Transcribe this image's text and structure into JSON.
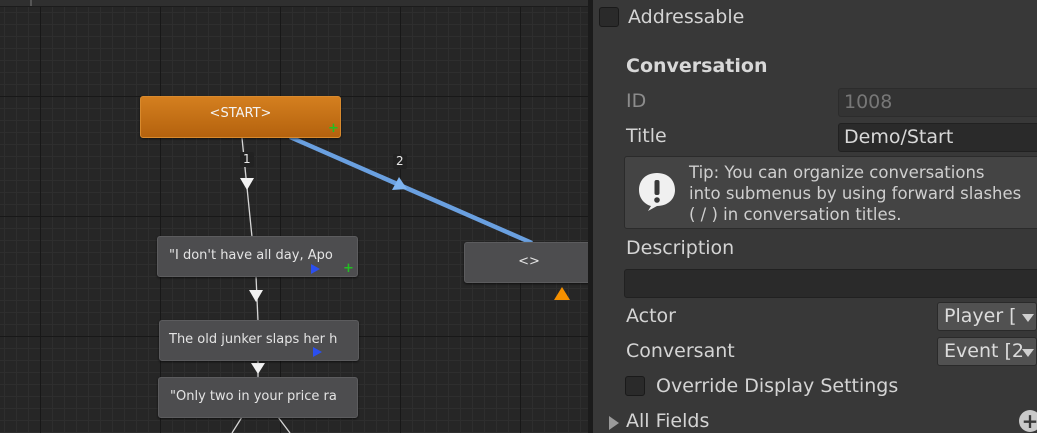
{
  "graph": {
    "nodes": {
      "start": {
        "label": "<START>"
      },
      "node1": {
        "label": "\"I don't have all day, Apo"
      },
      "node2": {
        "label": "The old junker slaps her h"
      },
      "node3": {
        "label": "\"Only two in your price ra"
      },
      "node4": {
        "label": "<>"
      }
    },
    "links": {
      "link1": "1",
      "link2": "2"
    },
    "colors": {
      "start_node": "#c87019",
      "highlight_link": "#6aa0e0",
      "output_plus": "#22c022",
      "entry_arrow": "#2b4ff0",
      "warning_arrow": "#f59000"
    }
  },
  "inspector": {
    "addressable": {
      "label": "Addressable",
      "checked": false
    },
    "conversation_header": "Conversation",
    "id": {
      "label": "ID",
      "value": "1008"
    },
    "title": {
      "label": "Title",
      "value": "Demo/Start"
    },
    "tip": {
      "line1": "Tip: You can organize conversations",
      "line2": "into submenus by using forward slashes",
      "line3": "( / ) in conversation titles."
    },
    "description": {
      "label": "Description",
      "value": ""
    },
    "actor": {
      "label": "Actor",
      "value": "Player ["
    },
    "conversant": {
      "label": "Conversant",
      "value": "Event [2"
    },
    "override": {
      "label": "Override Display Settings",
      "checked": false
    },
    "all_fields": {
      "label": "All Fields"
    }
  }
}
